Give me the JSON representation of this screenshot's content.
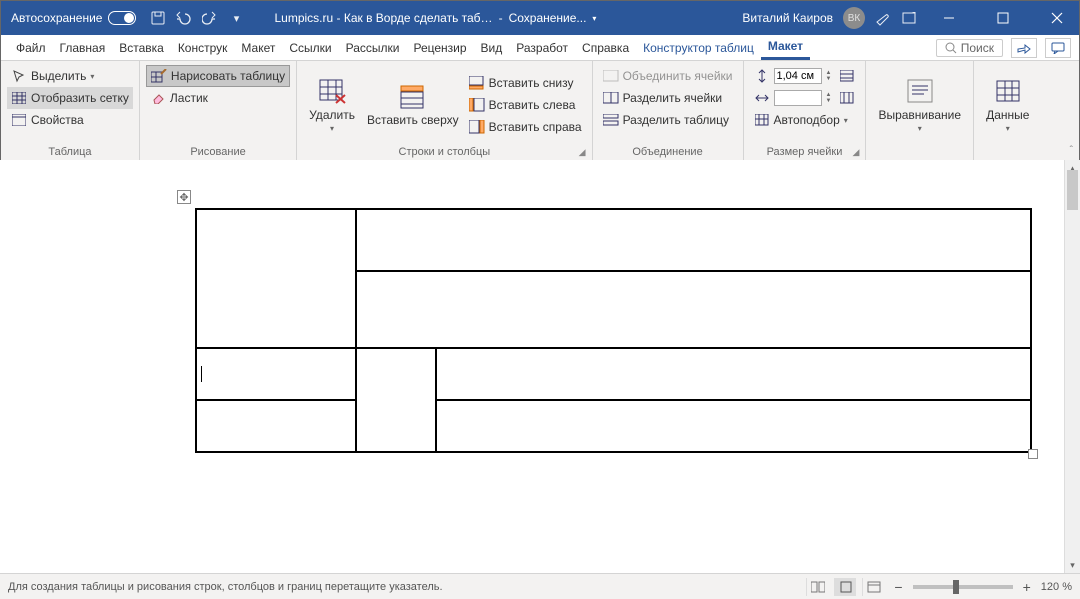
{
  "titleBar": {
    "autosave": "Автосохранение",
    "docTitle": "Lumpics.ru - Как в Ворде сделать таб…",
    "savingStatus": "Сохранение...",
    "userName": "Виталий Каиров",
    "userInitials": "ВК"
  },
  "tabs": {
    "file": "Файл",
    "home": "Главная",
    "insert": "Вставка",
    "design": "Конструк",
    "layout": "Макет",
    "references": "Ссылки",
    "mailings": "Рассылки",
    "review": "Рецензир",
    "view": "Вид",
    "developer": "Разработ",
    "help": "Справка",
    "tableDesign": "Конструктор таблиц",
    "tableLayout": "Макет",
    "searchPlaceholder": "Поиск"
  },
  "ribbon": {
    "tableGroup": {
      "label": "Таблица",
      "select": "Выделить",
      "viewGridlines": "Отобразить сетку",
      "properties": "Свойства"
    },
    "drawGroup": {
      "label": "Рисование",
      "drawTable": "Нарисовать таблицу",
      "eraser": "Ластик"
    },
    "rowsColsGroup": {
      "label": "Строки и столбцы",
      "delete": "Удалить",
      "insertAbove": "Вставить сверху",
      "insertBelow": "Вставить снизу",
      "insertLeft": "Вставить слева",
      "insertRight": "Вставить справа"
    },
    "mergeGroup": {
      "label": "Объединение",
      "mergeCells": "Объединить ячейки",
      "splitCells": "Разделить ячейки",
      "splitTable": "Разделить таблицу"
    },
    "cellSizeGroup": {
      "label": "Размер ячейки",
      "height": "1,04 см",
      "widthEmpty": "",
      "autoFit": "Автоподбор"
    },
    "alignmentGroup": {
      "label": "Выравнивание"
    },
    "dataGroup": {
      "label": "Данные"
    }
  },
  "status": {
    "hint": "Для создания таблицы и рисования строк, столбцов и границ перетащите указатель.",
    "zoom": "120 %"
  }
}
